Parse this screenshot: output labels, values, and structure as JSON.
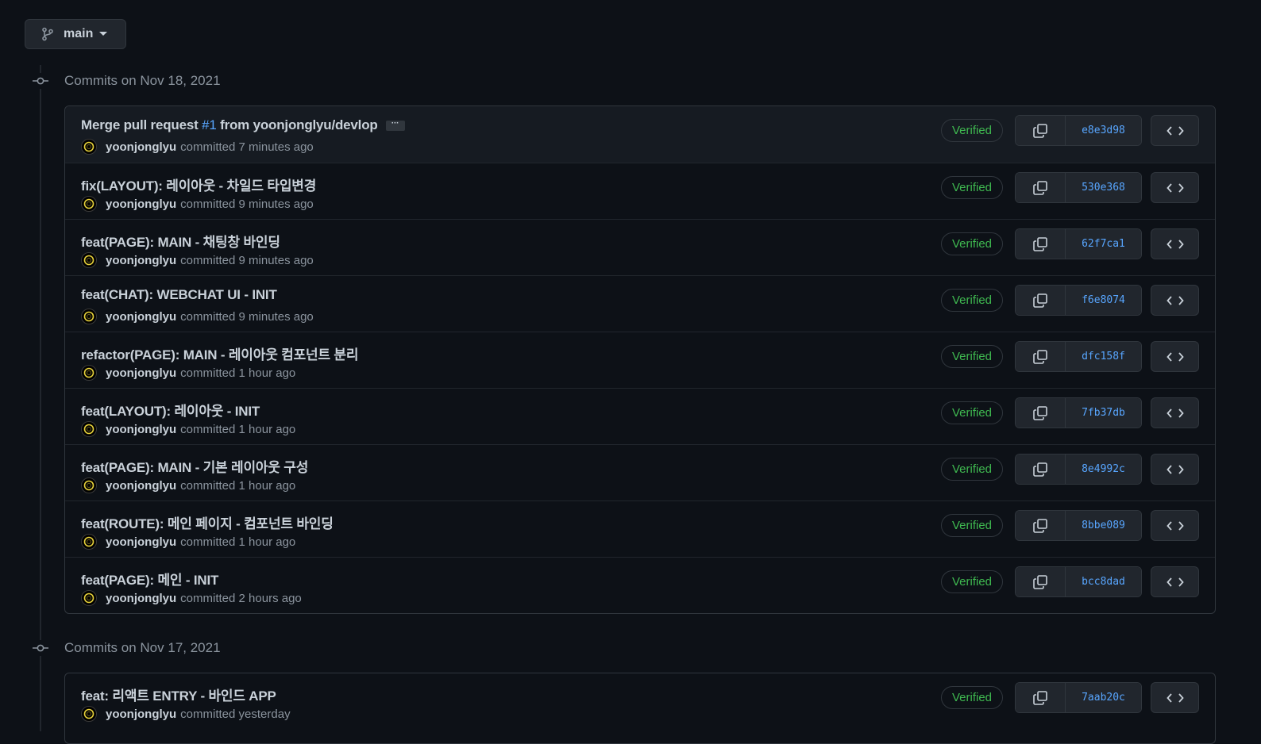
{
  "branch": {
    "name": "main"
  },
  "groups": [
    {
      "title": "Commits on Nov 18, 2021",
      "commits": [
        {
          "title_before": "Merge pull request ",
          "pr": "#1",
          "title_after": " from yoonjonglyu/devlop",
          "has_ellipsis": true,
          "ellipsis": "···",
          "author": "yoonjonglyu",
          "action": "committed",
          "time": "7 minutes ago",
          "verified": "Verified",
          "sha": "e8e3d98"
        },
        {
          "title": "fix(LAYOUT): 레이아웃 - 차일드 타입변경",
          "author": "yoonjonglyu",
          "action": "committed",
          "time": "9 minutes ago",
          "verified": "Verified",
          "sha": "530e368"
        },
        {
          "title": "feat(PAGE): MAIN - 채팅창 바인딩",
          "author": "yoonjonglyu",
          "action": "committed",
          "time": "9 minutes ago",
          "verified": "Verified",
          "sha": "62f7ca1"
        },
        {
          "title": "feat(CHAT): WEBCHAT UI - INIT",
          "author": "yoonjonglyu",
          "action": "committed",
          "time": "9 minutes ago",
          "verified": "Verified",
          "sha": "f6e8074"
        },
        {
          "title": "refactor(PAGE): MAIN - 레이아웃 컴포넌트 분리",
          "author": "yoonjonglyu",
          "action": "committed",
          "time": "1 hour ago",
          "verified": "Verified",
          "sha": "dfc158f"
        },
        {
          "title": "feat(LAYOUT): 레이아웃 - INIT",
          "author": "yoonjonglyu",
          "action": "committed",
          "time": "1 hour ago",
          "verified": "Verified",
          "sha": "7fb37db"
        },
        {
          "title": "feat(PAGE): MAIN - 기본 레이아웃 구성",
          "author": "yoonjonglyu",
          "action": "committed",
          "time": "1 hour ago",
          "verified": "Verified",
          "sha": "8e4992c"
        },
        {
          "title": "feat(ROUTE): 메인 페이지 - 컴포넌트 바인딩",
          "author": "yoonjonglyu",
          "action": "committed",
          "time": "1 hour ago",
          "verified": "Verified",
          "sha": "8bbe089"
        },
        {
          "title": "feat(PAGE): 메인 - INIT",
          "author": "yoonjonglyu",
          "action": "committed",
          "time": "2 hours ago",
          "verified": "Verified",
          "sha": "bcc8dad"
        }
      ]
    },
    {
      "title": "Commits on Nov 17, 2021",
      "commits": [
        {
          "title": "feat: 리액트 ENTRY - 바인드 APP",
          "author": "yoonjonglyu",
          "action": "committed",
          "time": "yesterday",
          "verified": "Verified",
          "sha": "7aab20c"
        }
      ]
    }
  ],
  "colors": {
    "background": "#0d1117",
    "link": "#58a6ff",
    "verified": "#3fb950",
    "muted": "#8b949e"
  },
  "icons": {
    "branch": "git-branch-icon",
    "commit": "git-commit-icon",
    "copy": "copy-icon",
    "browse": "code-icon",
    "caret": "triangle-down-icon"
  }
}
